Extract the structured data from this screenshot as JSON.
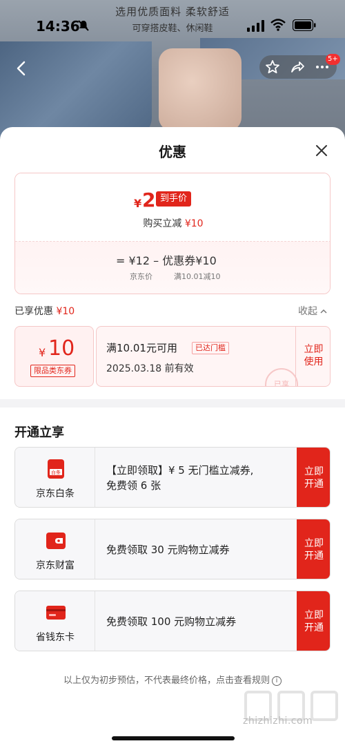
{
  "status_bar": {
    "time": "14:36",
    "ad_line1": "选用优质面料  柔软舒适",
    "ad_line2": "可穿搭皮鞋、休闲鞋"
  },
  "nav": {
    "badge": "5+"
  },
  "sheet": {
    "title": "优惠",
    "price": {
      "currency": "¥",
      "amount": "2",
      "tag": "到手价",
      "sub_prefix": "购买立减",
      "sub_value": "¥10",
      "calc": "=  ¥12   –  优惠券¥10",
      "label_jd_price": "京东价",
      "label_coupon": "满10.01减10"
    },
    "enjoyed": {
      "label": "已享优惠",
      "value": "¥10",
      "collapse": "收起"
    },
    "coupon": {
      "currency": "¥",
      "amount": "10",
      "type": "限品类东券",
      "condition": "满10.01元可用",
      "badge": "已达门槛",
      "expiry": "2025.03.18 前有效",
      "stamp": "已享",
      "use_line1": "立即",
      "use_line2": "使用"
    },
    "open_title": "开通立享",
    "services": [
      {
        "name": "京东白条",
        "icon": "baitiao-icon",
        "icon_text": "白条",
        "desc_line1": "【立即领取】¥ 5 无门槛立减券,",
        "desc_line2": "免费领 6 张",
        "btn_line1": "立即",
        "btn_line2": "开通"
      },
      {
        "name": "京东财富",
        "icon": "wallet-icon",
        "desc_line1": "免费领取 30 元购物立减券",
        "desc_line2": "",
        "btn_line1": "立即",
        "btn_line2": "开通"
      },
      {
        "name": "省钱东卡",
        "icon": "card-icon",
        "desc_line1": "免费领取 100 元购物立减券",
        "desc_line2": "",
        "btn_line1": "立即",
        "btn_line2": "开通"
      }
    ],
    "disclaimer": "以上仅为初步预估，不代表最终价格，点击查看规则",
    "watermark": "zhizhizhi.com"
  },
  "colors": {
    "accent": "#e1251b",
    "light_pink": "#fff1f1"
  }
}
